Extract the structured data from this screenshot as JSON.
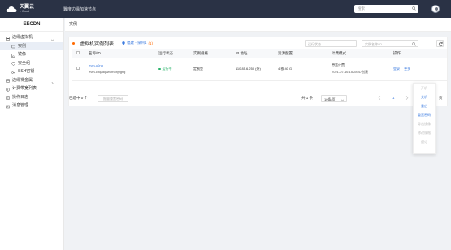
{
  "topbar": {
    "brand": "天翼云",
    "brand_sub": "e Cloud",
    "product": "翼度边缘加速节点",
    "search_placeholder": "搜索"
  },
  "sidebar": {
    "title": "EECDN",
    "items": [
      {
        "label": "边缘虚拟机",
        "icon": "server-icon",
        "expanded": true
      },
      {
        "label": "实例",
        "icon": "instance-icon",
        "active": true
      },
      {
        "label": "镜像",
        "icon": "image-icon"
      },
      {
        "label": "安全组",
        "icon": "shield-icon"
      },
      {
        "label": "SSH密钥",
        "icon": "key-icon"
      },
      {
        "label": "边缘裸金属",
        "icon": "baremetal-icon",
        "expanded": false
      },
      {
        "label": "计费带宽列表",
        "icon": "billing-icon"
      },
      {
        "label": "操作日志",
        "icon": "log-icon"
      },
      {
        "label": "消息管理",
        "icon": "message-icon"
      }
    ]
  },
  "breadcrumb": "实例",
  "panel": {
    "title": "虚拟机实例列表",
    "region": "福建 - 泉州1",
    "region_count": "(1)",
    "status_placeholder": "运行状态",
    "name_placeholder": "实例名称/ID"
  },
  "table": {
    "headers": [
      "名称/ID",
      "运行状态",
      "实例规格",
      "IP 地址",
      "资源配置",
      "计费模式",
      "操作"
    ],
    "rows": [
      {
        "name": "evm-u0ng",
        "id": "evm-c9qatqsw0h99lj9gng",
        "status": "运行中",
        "spec": "定制型",
        "ip": "110.85.6.250 (外)",
        "resources": "4 核 40 G",
        "billing": "带宽计费",
        "created": "2021-07-16 15:28:47创建",
        "actions": [
          "登录",
          "更多"
        ]
      }
    ]
  },
  "footer": {
    "selected": "已选中 0 个",
    "batch_button": "批量重置密码",
    "total": "共 1 条",
    "page_size": "10条/页",
    "current_page": "1",
    "goto_value": "1",
    "goto_label": "页"
  },
  "more_menu": [
    {
      "label": "开机",
      "enabled": false
    },
    {
      "label": "关机",
      "enabled": true
    },
    {
      "label": "重启",
      "enabled": true
    },
    {
      "label": "重置密码",
      "enabled": true
    },
    {
      "label": "导出镜像",
      "enabled": false
    },
    {
      "label": "修改规格",
      "enabled": false
    },
    {
      "label": "退订",
      "enabled": false
    }
  ],
  "colors": {
    "topbar": "#2a3245",
    "accent": "#3f7de0",
    "running": "#29b36a",
    "orange": "#ff6a00"
  }
}
